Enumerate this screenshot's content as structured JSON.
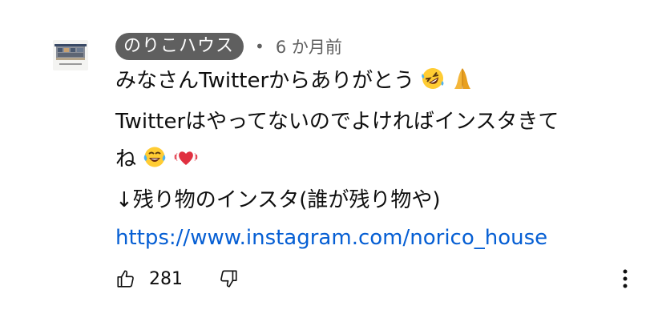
{
  "comment": {
    "author": "のりこハウス",
    "separator": "•",
    "time": "6 か月前",
    "avatar_caption": "Norico's house",
    "lines": [
      "みなさんTwitterからありがとう",
      "Twitterはやってないのでよければインスタきて",
      "ね",
      "↓残り物のインスタ(誰が残り物や)"
    ],
    "link": "https://www.instagram.com/norico_house",
    "like_count": "281",
    "icons": {
      "line1_emoji": [
        "rolling-on-floor-laughing-emoji",
        "folded-hands-emoji"
      ],
      "line3_emoji": [
        "tears-of-joy-emoji",
        "beating-heart-emoji"
      ],
      "like": "thumbs-up-icon",
      "dislike": "thumbs-down-icon",
      "more": "vertical-ellipsis-icon"
    },
    "colors": {
      "author_chip": "#5f5f5f",
      "link": "#065fd4",
      "secondary_text": "#606060"
    }
  }
}
